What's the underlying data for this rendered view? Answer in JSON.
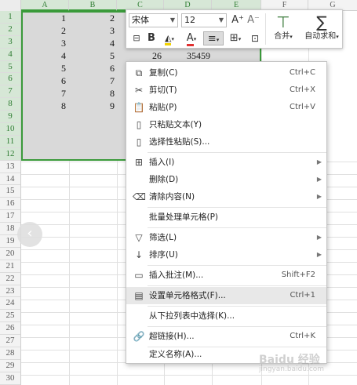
{
  "columns": [
    "A",
    "B",
    "C",
    "D",
    "E",
    "F",
    "G"
  ],
  "rows": [
    "1",
    "2",
    "3",
    "4",
    "5",
    "6",
    "7",
    "8",
    "9",
    "10",
    "11",
    "12",
    "13",
    "14",
    "15",
    "16",
    "17",
    "18",
    "19",
    "20",
    "21",
    "22",
    "23",
    "24",
    "25",
    "26",
    "27",
    "28",
    "29",
    "30"
  ],
  "cells": {
    "colA": [
      "1",
      "2",
      "3",
      "4",
      "5",
      "6",
      "7",
      "8"
    ],
    "colB": [
      "2",
      "3",
      "4",
      "5",
      "6",
      "7",
      "8",
      "9"
    ],
    "c4": "26",
    "d4": "35459"
  },
  "mini_toolbar": {
    "font_name": "宋体",
    "font_size": "12",
    "grow_font": "A⁺",
    "shrink_font": "A⁻",
    "bold": "B",
    "merge_label": "合并",
    "autosum_label": "自动求和"
  },
  "context_menu": {
    "copy": {
      "label": "复制(C)",
      "shortcut": "Ctrl+C"
    },
    "cut": {
      "label": "剪切(T)",
      "shortcut": "Ctrl+X"
    },
    "paste": {
      "label": "粘贴(P)",
      "shortcut": "Ctrl+V"
    },
    "paste_text": {
      "label": "只粘贴文本(Y)"
    },
    "paste_special": {
      "label": "选择性粘贴(S)..."
    },
    "insert": {
      "label": "插入(I)"
    },
    "delete": {
      "label": "删除(D)"
    },
    "clear": {
      "label": "清除内容(N)"
    },
    "batch": {
      "label": "批量处理单元格(P)"
    },
    "filter": {
      "label": "筛选(L)"
    },
    "sort": {
      "label": "排序(U)"
    },
    "comment": {
      "label": "插入批注(M)...",
      "shortcut": "Shift+F2"
    },
    "format_cells": {
      "label": "设置单元格格式(F)...",
      "shortcut": "Ctrl+1"
    },
    "dropdown_pick": {
      "label": "从下拉列表中选择(K)..."
    },
    "hyperlink": {
      "label": "超链接(H)...",
      "shortcut": "Ctrl+K"
    },
    "define_name": {
      "label": "定义名称(A)..."
    }
  },
  "watermark": {
    "main": "Baidu 经验",
    "sub": "jingyan.baidu.com"
  },
  "colors": {
    "selection_border": "#3a9a3a",
    "selection_fill": "#d9d9d9",
    "header_selected": "#d6e7d6",
    "menu_highlight": "#e8e8e8"
  }
}
